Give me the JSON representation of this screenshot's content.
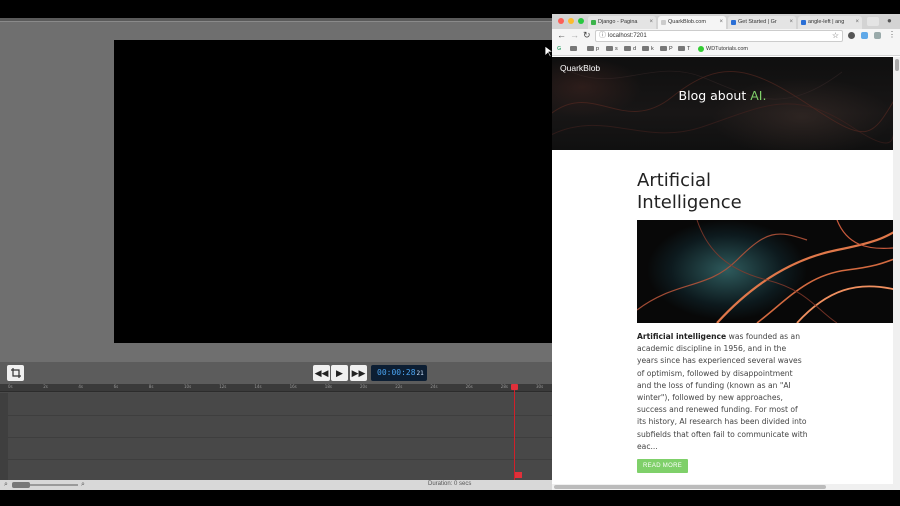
{
  "editor": {
    "timecode": "00:00:28",
    "timecode_frames": "21",
    "ruler_ticks": [
      "0s",
      "2s",
      "4s",
      "6s",
      "8s",
      "10s",
      "12s",
      "14s",
      "16s",
      "18s",
      "20s",
      "22s",
      "24s",
      "26s",
      "28s",
      "30s"
    ],
    "duration": "Duration: 0 secs",
    "controls": {
      "crop": "crop-icon",
      "rewind": "◀◀",
      "play": "▶",
      "fast_forward": "▶▶"
    }
  },
  "browser": {
    "tabs": [
      {
        "title": "Django - Pagina",
        "icon_color": "#3cb44b"
      },
      {
        "title": "QuarkBlob.com",
        "icon_color": "#cccccc"
      },
      {
        "title": "Get Started | Gr",
        "icon_color": "#2a6fd6"
      },
      {
        "title": "angle-left | ang",
        "icon_color": "#2a6fd6"
      }
    ],
    "url": "localhost:7201",
    "bookmarks": [
      "p",
      "s",
      "d",
      "k",
      "P",
      "T"
    ],
    "bookmark_site": "WDTutorials.com"
  },
  "site": {
    "brand": "QuarkBlob",
    "hero_prefix": "Blog about ",
    "hero_accent": "AI",
    "hero_suffix": ".",
    "accent_color": "#7fd06a",
    "article": {
      "title": "Artificial Intelligence",
      "lead_bold": "Artificial intelligence",
      "body": " was founded as an academic discipline in 1956, and in the years since has experienced several waves of optimism, followed by disappointment and the loss of funding (known as an \"AI winter\"), followed by new approaches, success and renewed funding. For most of its history, AI research has been divided into subfields that often fail to communicate with eac...",
      "read_more": "READ MORE"
    }
  }
}
